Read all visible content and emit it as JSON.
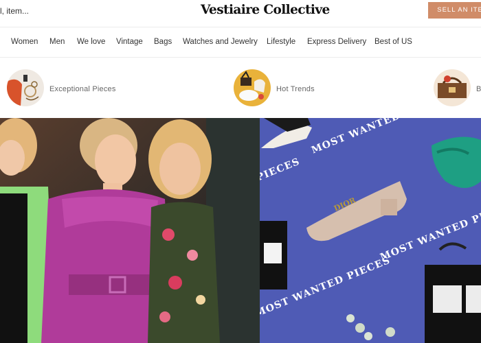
{
  "header": {
    "search_text": "l, item...",
    "logo": "Vestiaire Collective",
    "sell_label": "SELL AN ITEM"
  },
  "nav": {
    "items": [
      "Women",
      "Men",
      "We love",
      "Vintage",
      "Bags",
      "Watches and Jewelry",
      "Lifestyle",
      "Express Delivery",
      "Best of US"
    ]
  },
  "categories": [
    {
      "label": "Exceptional Pieces",
      "icon": "exceptional-pieces-thumbnail"
    },
    {
      "label": "Hot Trends",
      "icon": "hot-trends-thumbnail"
    },
    {
      "label": "B",
      "icon": "category-thumbnail"
    }
  ],
  "hero": {
    "right_text": [
      "MOST WANTED PIECES",
      "MOST WANTED PIECES",
      "MOST WANTED PIECES",
      "MOST WANTED PIECES",
      "PIECES"
    ]
  },
  "colors": {
    "sell_button": "#d08c68",
    "hero_right_bg": "#4f5bb5"
  }
}
